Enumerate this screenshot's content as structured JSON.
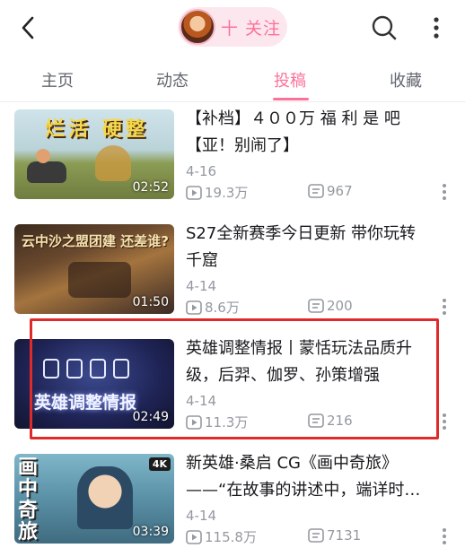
{
  "header": {
    "back_icon": "chevron-left-icon",
    "follow_label": "十 关注",
    "search_icon": "search-icon",
    "more_icon": "more-vertical-icon"
  },
  "tabs": [
    {
      "label": "主页",
      "active": false
    },
    {
      "label": "动态",
      "active": false
    },
    {
      "label": "投稿",
      "active": true
    },
    {
      "label": "收藏",
      "active": false
    }
  ],
  "accent_color": "#fb7299",
  "highlight_color": "#e02a2a",
  "videos": [
    {
      "title_line1": "【补档】４００万 福 利 是 吧",
      "title_line2": "【亚！别闹了】",
      "thumb_text": "烂活 硬整",
      "duration": "02:52",
      "date": "4-16",
      "plays": "19.3万",
      "comments": "967"
    },
    {
      "title_line1": "S27全新赛季今日更新 带你玩转",
      "title_line2": "千窟",
      "thumb_text": "云中沙之盟团建 还差谁?",
      "duration": "01:50",
      "date": "4-14",
      "plays": "8.6万",
      "comments": "200"
    },
    {
      "title_line1": "英雄调整情报丨蒙恬玩法品质升",
      "title_line2": "级，后羿、伽罗、孙策增强",
      "thumb_text": "英雄调整情报",
      "duration": "02:49",
      "date": "4-14",
      "plays": "11.3万",
      "comments": "216"
    },
    {
      "title_line1": "新英雄·桑启 CG《画中奇旅》",
      "title_line2": "——“在故事的讲述中，端详时…",
      "thumb_text": "画中奇旅",
      "badge": "4K",
      "duration": "03:39",
      "date": "4-14",
      "plays": "115.8万",
      "comments": "7131"
    }
  ]
}
